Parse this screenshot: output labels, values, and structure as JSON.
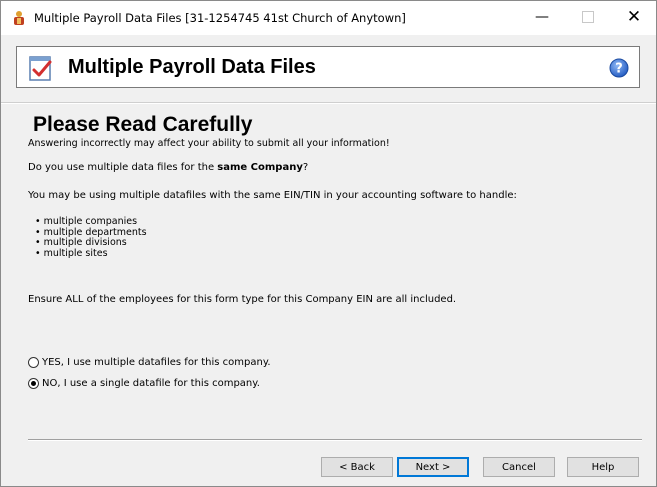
{
  "window": {
    "title": "Multiple Payroll Data Files [31-1254745 41st Church of Anytown]",
    "controls": {
      "minimize": "—",
      "close": "✕"
    }
  },
  "header": {
    "title": "Multiple Payroll Data Files",
    "icon": "checklist-icon",
    "help_icon": "help-icon"
  },
  "content": {
    "heading": "Please Read Carefully",
    "subheading": "Answering incorrectly may affect your ability to submit all your information!",
    "question_prefix": "Do you use multiple data files for the ",
    "question_bold": "same Company",
    "question_suffix": "?",
    "intro": "You may be using multiple datafiles with the same EIN/TIN in your accounting software to handle:",
    "bullets": [
      "multiple companies",
      "multiple departments",
      "multiple divisions",
      "multiple sites"
    ],
    "ensure": "Ensure ALL of the employees for this form type for this Company EIN are all included."
  },
  "options": {
    "yes_label": "YES, I use multiple datafiles for this company.",
    "no_label": "NO, I use a single datafile for this company.",
    "selected": "no"
  },
  "buttons": {
    "back": "< Back",
    "next": "Next >",
    "cancel": "Cancel",
    "help": "Help"
  },
  "colors": {
    "focus_border": "#0078d7",
    "help_blue": "#2f6fd6",
    "check_red": "#d32f2f"
  }
}
